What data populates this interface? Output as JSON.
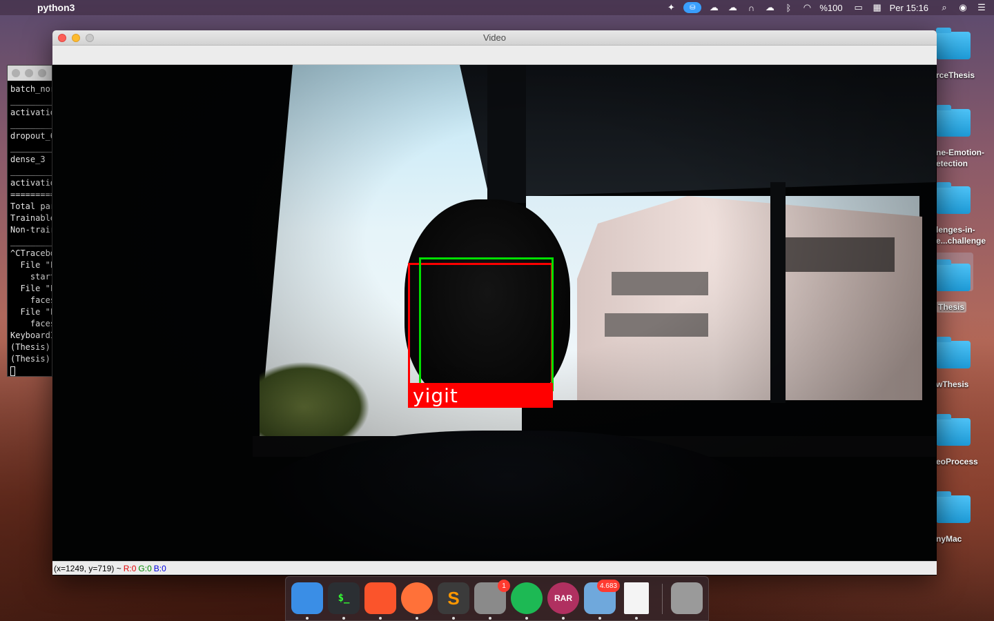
{
  "menubar": {
    "app_name": "python3",
    "battery_text": "%100",
    "clock": "Per 15:16",
    "icons": [
      "apple-icon",
      "notch-icon",
      "cloud-sync-icon",
      "cloudapp-icon",
      "icloud-icon",
      "headphones-icon",
      "cloud-icon",
      "bluetooth-icon",
      "wifi-icon",
      "battery-icon",
      "calendar-icon",
      "spotlight-icon",
      "siri-icon",
      "control-center-icon"
    ]
  },
  "terminal": {
    "lines": [
      "batch_nor",
      "__________",
      "activatio",
      "__________",
      "dropout_6",
      "__________",
      "dense_3 (",
      "__________",
      "activatio",
      "==========",
      "Total par",
      "Trainable",
      "Non-trair",
      "__________",
      "^CTracebo",
      "  File \"F",
      "    start",
      "  File \"F",
      "    faces",
      "  File \"F",
      "    faces",
      "KeyboardI",
      "(Thesis) ",
      "(Thesis) "
    ]
  },
  "desktop_icons": [
    {
      "label": "rceThesis"
    },
    {
      "label": "ne-Emotion-",
      "label2": "etection"
    },
    {
      "label": "lenges-in-",
      "label2": "e...challenge"
    },
    {
      "label": "Thesis",
      "selected": true
    },
    {
      "label": "wThesis"
    },
    {
      "label": "eoProcess"
    },
    {
      "label": "nyMac"
    }
  ],
  "window": {
    "title": "Video",
    "face_label": "yigit",
    "status": {
      "coords": "(x=1249, y=719) ~",
      "r": "R:0",
      "g": "G:0",
      "b": "B:0"
    }
  },
  "dock": {
    "apps": [
      {
        "name": "Finder",
        "icon": "finder-icon",
        "color": "#3a8ee6"
      },
      {
        "name": "Terminal",
        "icon": "terminal-icon",
        "color": "#2b2f33",
        "glyph": "$_"
      },
      {
        "name": "Brave",
        "icon": "brave-icon",
        "color": "#fb542b"
      },
      {
        "name": "Firefox",
        "icon": "firefox-icon",
        "color": "#ff7139"
      },
      {
        "name": "Sublime Text",
        "icon": "sublime-icon",
        "color": "#3b3b3b",
        "glyph": "S"
      },
      {
        "name": "System Preferences",
        "icon": "system-preferences-icon",
        "color": "#8a8a8a",
        "badge": "1"
      },
      {
        "name": "Spotify",
        "icon": "spotify-icon",
        "color": "#1db954"
      },
      {
        "name": "RAR Extractor",
        "icon": "rar-icon",
        "color": "#b03060",
        "glyph": "RAR"
      },
      {
        "name": "Mail",
        "icon": "mail-icon",
        "color": "#6fa8dc",
        "badge": "4.683"
      },
      {
        "name": "Document",
        "icon": "document-icon",
        "color": "#f4f4f4"
      },
      {
        "name": "Trash",
        "icon": "trash-icon",
        "color": "#9a9a9a"
      }
    ]
  }
}
